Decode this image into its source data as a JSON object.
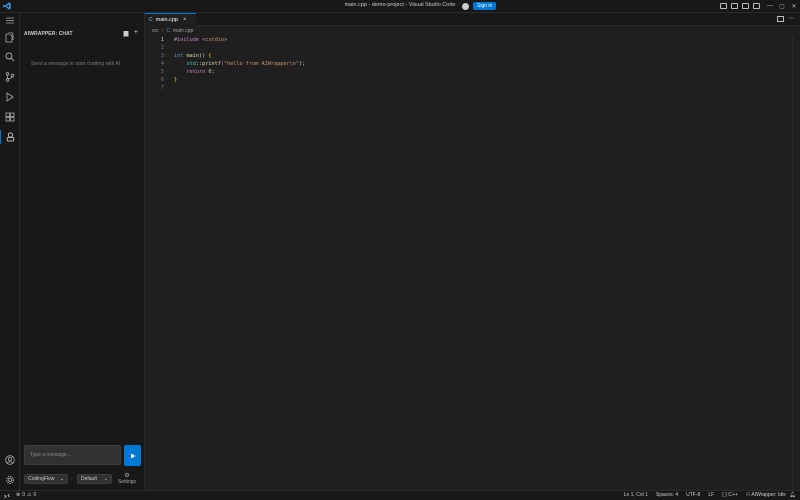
{
  "titlebar": {
    "title": "main.cpp - demo-project - Visual Studio Code",
    "signin_label": "Sign in"
  },
  "sidebar": {
    "title": "AIWRAPPER: CHAT",
    "empty_message": "Send a message to start chatting with AI.",
    "input_placeholder": "Type a message...",
    "mode_select": "CodingFlow",
    "model_select": "Default",
    "settings_label": "Settings"
  },
  "editor": {
    "tab_label": "main.cpp",
    "breadcrumb": [
      "src",
      "main.cpp"
    ],
    "line_numbers": [
      "1",
      "2",
      "3",
      "4",
      "5",
      "6",
      "7"
    ],
    "lines": [
      [
        "#include",
        " ",
        "<cstdio>"
      ],
      [],
      [
        "int",
        " ",
        "main",
        "() ",
        "{"
      ],
      [
        "    ",
        "std",
        "::",
        "printf",
        "(",
        "\"hello from AIWrapper\\n\"",
        ");"
      ],
      [
        "    ",
        "return",
        " ",
        "0",
        ";"
      ],
      [
        "}"
      ],
      []
    ]
  },
  "statusbar": {
    "errors": "0",
    "warnings": "0",
    "position": "Ln 1, Col 1",
    "spaces": "Spaces: 4",
    "encoding": "UTF-8",
    "eol": "LF",
    "language": "C++",
    "extension_status": "AIWrapper: Idle"
  },
  "colors": {
    "accent": "#0078d4",
    "editor_bg": "#1f1f1f",
    "chrome_bg": "#181818"
  }
}
